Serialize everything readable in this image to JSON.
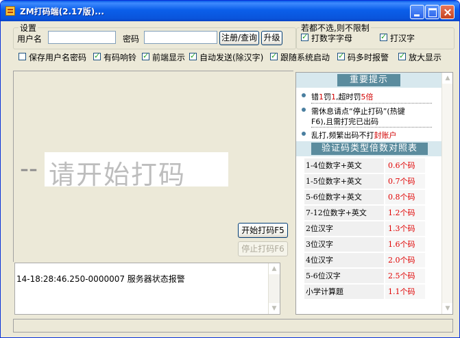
{
  "window": {
    "title": "ZM打码端(2.17版)..."
  },
  "settings": {
    "legend": "设置",
    "username_label": "用户名",
    "username_value": "",
    "password_label": "密码",
    "password_value": "",
    "register_button": "注册/查询",
    "upgrade_button": "升级"
  },
  "restrict": {
    "legend": "若都不选,则不限制",
    "options": [
      {
        "label": "打数字字母",
        "checked": true
      },
      {
        "label": "打汉字",
        "checked": true
      }
    ]
  },
  "options": [
    {
      "label": "保存用户名密码",
      "checked": false
    },
    {
      "label": "有码响铃",
      "checked": true
    },
    {
      "label": "前端显示",
      "checked": true
    },
    {
      "label": "自动发送(除汉字)",
      "checked": true
    },
    {
      "label": "跟随系统启动",
      "checked": true
    },
    {
      "label": "码多时报警",
      "checked": true
    },
    {
      "label": "放大显示",
      "checked": true
    }
  ],
  "main": {
    "dashes": "--",
    "prompt": "请开始打码",
    "start_button": "开始打码F5",
    "stop_button": "停止打码F6"
  },
  "log": {
    "lines": [
      "14-18:28:46.250-0000007 服务器状态报警"
    ]
  },
  "notice": {
    "title": "重要提示",
    "tip1": {
      "a": "错",
      "b": "1",
      "c": "罚",
      "d": "1",
      "e": ",超时罚",
      "f": "5倍"
    },
    "tip2": {
      "line1": "需休息请点“停止打码”(热键",
      "line2": "F6),且需打完已出码"
    },
    "tip3": {
      "a": "乱打,频繁出码不打",
      "b": "封账户"
    }
  },
  "table": {
    "title": "验证码类型倍数对照表",
    "rows": [
      {
        "type": "1-4位数字+英文",
        "mult": "0.6个码"
      },
      {
        "type": "1-5位数字+英文",
        "mult": "0.7个码"
      },
      {
        "type": "5-6位数字+英文",
        "mult": "0.8个码"
      },
      {
        "type": "7-12位数字+英文",
        "mult": "1.2个码"
      },
      {
        "type": "2位汉字",
        "mult": "1.3个码"
      },
      {
        "type": "3位汉字",
        "mult": "1.6个码"
      },
      {
        "type": "4位汉字",
        "mult": "2.0个码"
      },
      {
        "type": "5-6位汉字",
        "mult": "2.5个码"
      },
      {
        "type": "小学计算题",
        "mult": "1.1个码"
      }
    ]
  },
  "colors": {
    "title_bar": "#0a5be8",
    "banner": "#5b8c9e",
    "accent_red": "#d10000"
  }
}
